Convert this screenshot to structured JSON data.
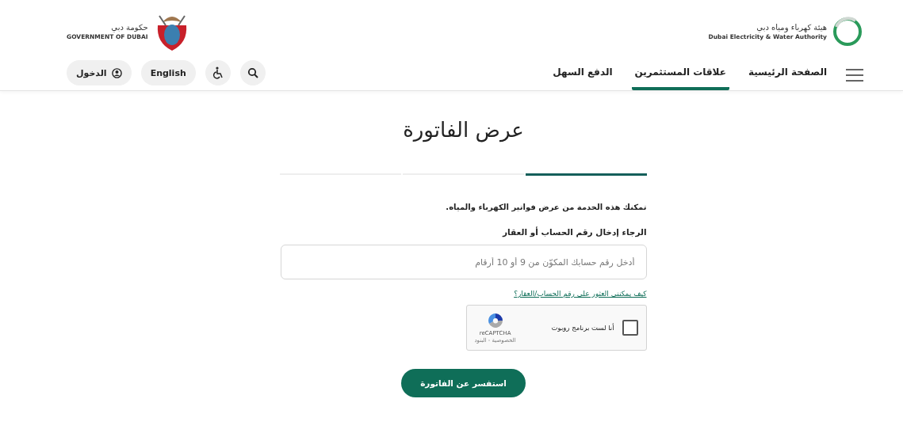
{
  "header": {
    "authority_logo": {
      "name_ar": "هيئة كهرباء ومياه دبي",
      "name_en": "Dubai Electricity & Water Authority"
    },
    "government_logo": {
      "name_ar": "حكومة دبي",
      "name_en": "GOVERNMENT OF DUBAI"
    },
    "nav": [
      {
        "label": "الصفحة الرئيسية",
        "selected": false
      },
      {
        "label": "علاقات المستثمرين",
        "selected": true
      },
      {
        "label": "الدفع السهل",
        "selected": false
      }
    ],
    "language_button": "English",
    "login_button": "الدخول"
  },
  "page_title": "عرض الفاتورة",
  "steps": [
    {
      "active": true
    },
    {
      "active": false
    },
    {
      "active": false
    }
  ],
  "form": {
    "intro": "تمكنك هذه الخدمة من عرض فواتير الكهرباء والمياه.",
    "field_label": "الرجاء إدخال رقم الحساب أو العقار",
    "placeholder": "أدخل رقم حسابك المكوّن من 9 أو 10 أرقام",
    "help_link": "كيف يمكنني العثور على رقم الحساب/العقار؟",
    "captcha": {
      "checked": false,
      "label": "أنا لست برنامج روبوت",
      "brand": "reCAPTCHA",
      "terms": "الخصوصية - البنود"
    },
    "submit": "استفسر عن الفاتورة"
  }
}
